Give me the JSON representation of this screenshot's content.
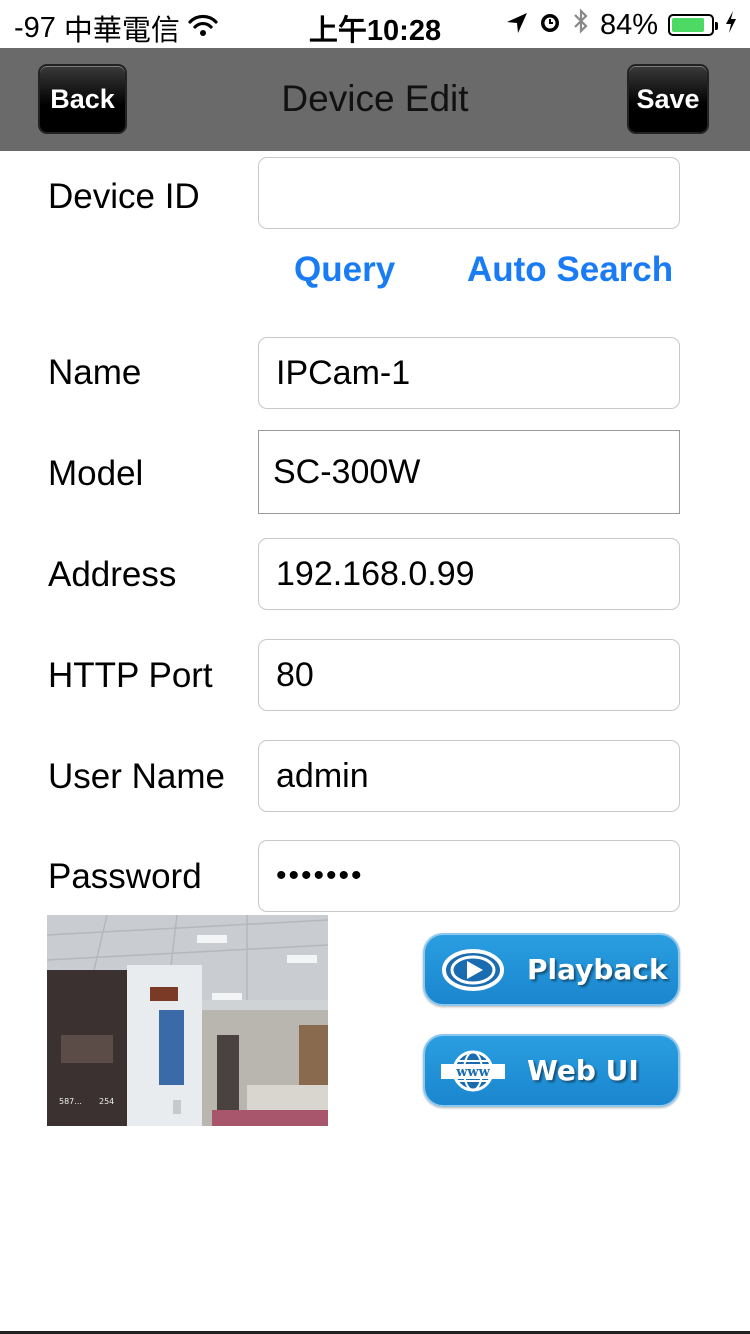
{
  "status_bar": {
    "signal": "-97",
    "carrier": "中華電信",
    "time": "上午10:28",
    "battery": "84%",
    "battery_level": 0.84,
    "battery_color": "#4cd964",
    "icons": [
      "wifi-icon",
      "location-arrow-icon",
      "alarm-icon",
      "bluetooth-icon",
      "battery-icon",
      "charging-icon"
    ]
  },
  "nav": {
    "title": "Device Edit",
    "back_label": "Back",
    "save_label": "Save"
  },
  "form": {
    "device_id_label": "Device ID",
    "device_id_value": "",
    "query_label": "Query",
    "auto_search_label": "Auto Search",
    "name_label": "Name",
    "name_value": "IPCam-1",
    "model_label": "Model",
    "model_value": "SC-300W",
    "address_label": "Address",
    "address_value": "192.168.0.99",
    "port_label": "HTTP Port",
    "port_value": "80",
    "username_label": "User Name",
    "username_value": "admin",
    "password_label": "Password",
    "password_value": "•••••••"
  },
  "actions": {
    "playback_label": "Playback",
    "webui_label": "Web UI"
  },
  "snapshot": {
    "overlay_left": "587...",
    "overlay_right": "254"
  },
  "colors": {
    "link": "#1a7cf5",
    "nav_bg": "#6a6a6a",
    "button_blue": "#1a86cf"
  }
}
